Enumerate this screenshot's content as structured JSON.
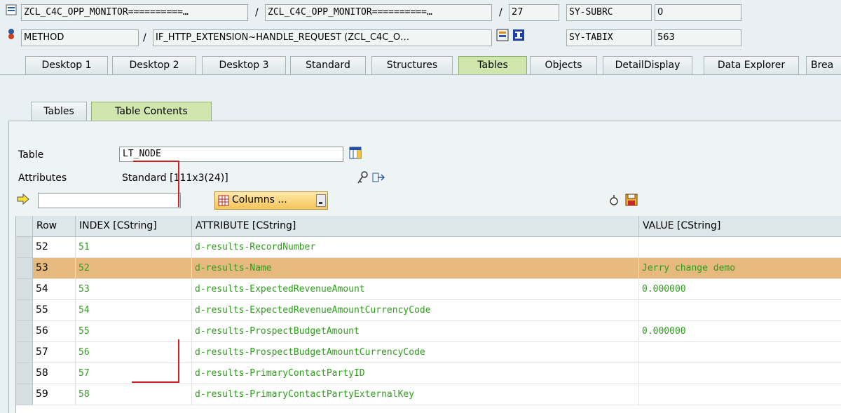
{
  "header": {
    "program_1": "ZCL_C4C_OPP_MONITOR==========…",
    "program_2": "ZCL_C4C_OPP_MONITOR==========…",
    "line": "27",
    "type": "METHOD",
    "event": "IF_HTTP_EXTENSION~HANDLE_REQUEST (ZCL_C4C_O…",
    "sy_fields": [
      {
        "name": "SY-SUBRC",
        "value": "0"
      },
      {
        "name": "SY-TABIX",
        "value": "563"
      }
    ],
    "sep_slash": "/"
  },
  "main_tabs": [
    "Desktop 1",
    "Desktop 2",
    "Desktop 3",
    "Standard",
    "Structures",
    "Tables",
    "Objects",
    "DetailDisplay",
    "Data Explorer",
    "Brea"
  ],
  "active_main_tab": "Tables",
  "sub_tabs": [
    "Tables",
    "Table Contents"
  ],
  "active_sub_tab": "Table Contents",
  "table_field": {
    "label": "Table",
    "value": "LT_NODE"
  },
  "attributes": {
    "label": "Attributes",
    "value": "Standard [111x3(24)]"
  },
  "filter": {
    "value": "",
    "columns_button": "Columns ..."
  },
  "grid": {
    "columns": [
      "Row",
      "INDEX [CString]",
      "ATTRIBUTE [CString]",
      "VALUE [CString]"
    ],
    "rows": [
      {
        "row": "52",
        "index": "51",
        "attribute": "d-results-RecordNumber",
        "value": ""
      },
      {
        "row": "53",
        "index": "52",
        "attribute": "d-results-Name",
        "value": "Jerry change demo"
      },
      {
        "row": "54",
        "index": "53",
        "attribute": "d-results-ExpectedRevenueAmount",
        "value": "0.000000"
      },
      {
        "row": "55",
        "index": "54",
        "attribute": "d-results-ExpectedRevenueAmountCurrencyCode",
        "value": ""
      },
      {
        "row": "56",
        "index": "55",
        "attribute": "d-results-ProspectBudgetAmount",
        "value": "0.000000"
      },
      {
        "row": "57",
        "index": "56",
        "attribute": "d-results-ProspectBudgetAmountCurrencyCode",
        "value": ""
      },
      {
        "row": "58",
        "index": "57",
        "attribute": "d-results-PrimaryContactPartyID",
        "value": ""
      },
      {
        "row": "59",
        "index": "58",
        "attribute": "d-results-PrimaryContactPartyExternalKey",
        "value": ""
      }
    ],
    "highlighted_row": "53"
  },
  "icons": [
    "program-icon",
    "method-icon",
    "program-info-icon",
    "table-settings-icon",
    "key-icon",
    "export-icon",
    "filter-arrow-icon",
    "columns-grid-icon",
    "dropdown-icon",
    "bomb-icon",
    "save-icon"
  ],
  "colors": {
    "active_tab": "#cfe7ad",
    "highlight_row": "#e6b97e",
    "value_text": "#2e9e1c",
    "annotation_red": "#d21f1f"
  }
}
